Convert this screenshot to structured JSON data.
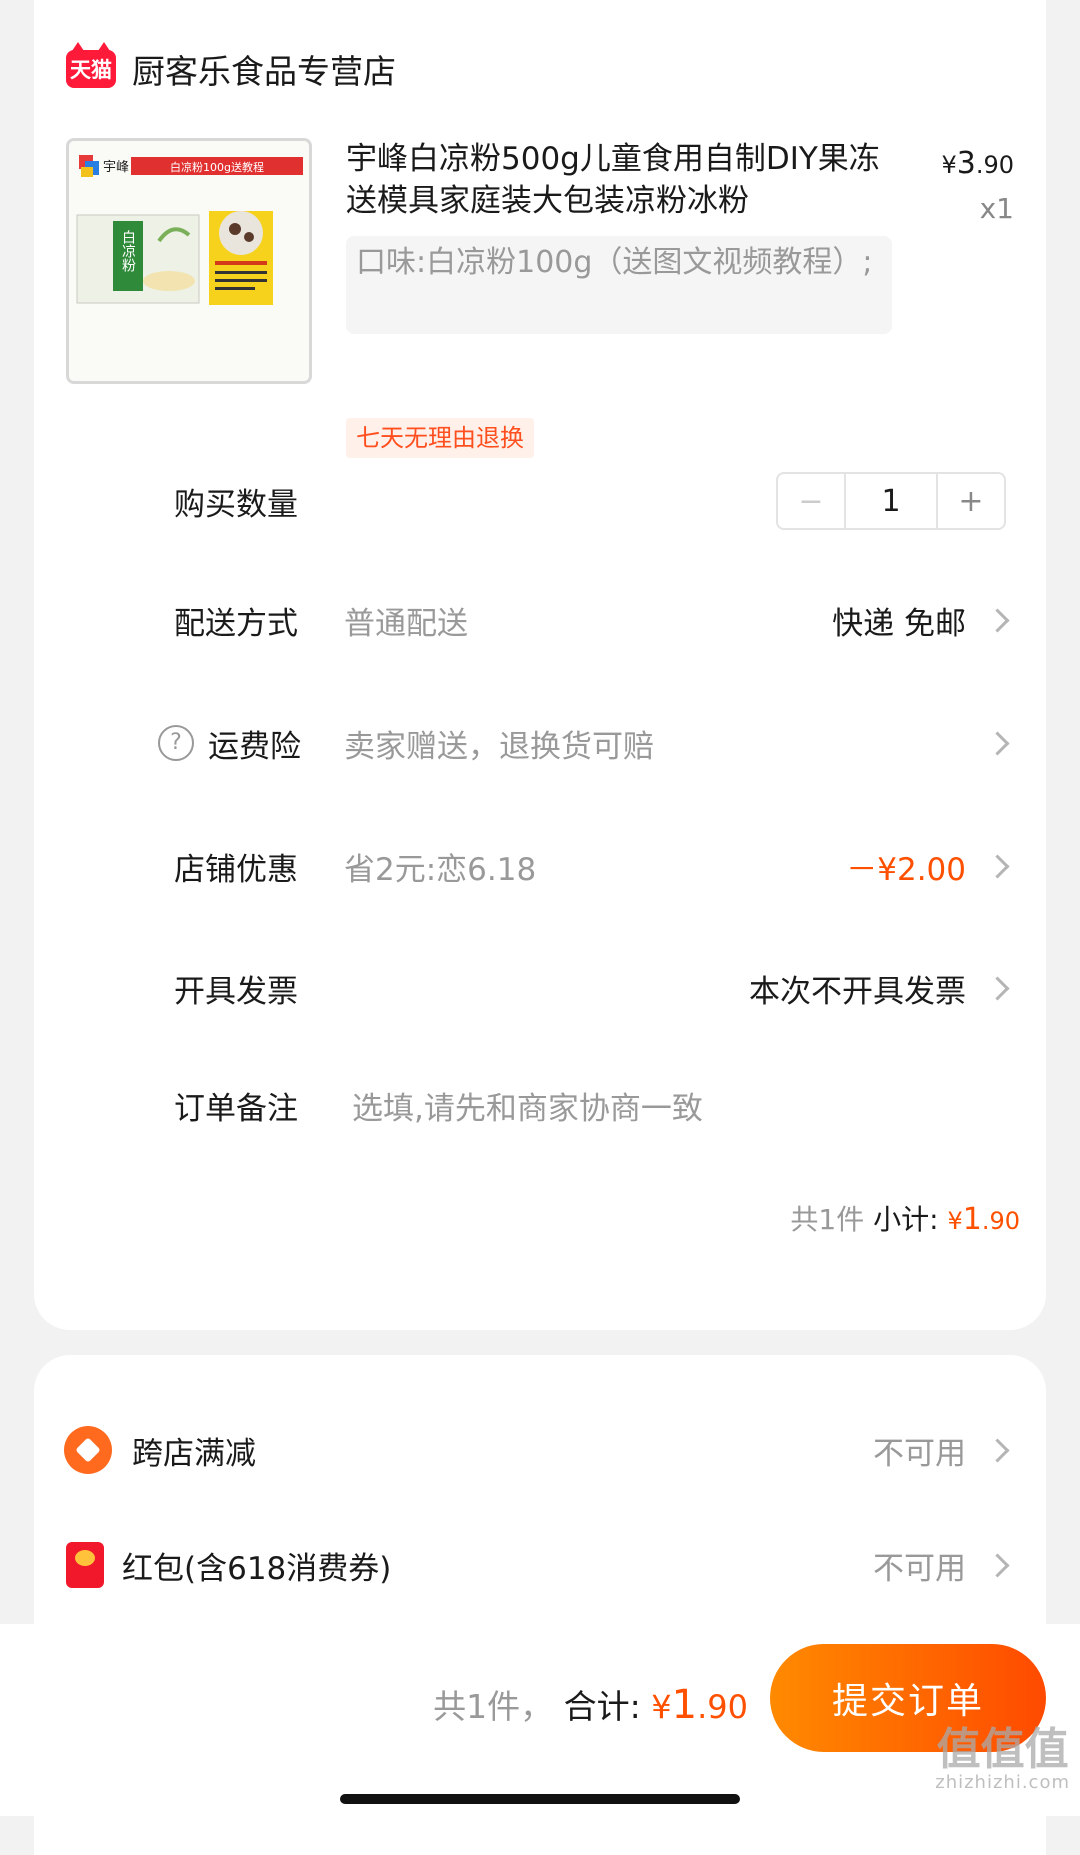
{
  "store": {
    "badge": "天猫",
    "name": "厨客乐食品专营店"
  },
  "product": {
    "image_banner": "白凉粉100g送教程",
    "image_brand": "宇峰",
    "image_pack_text": "白凉粉",
    "title": "宇峰白凉粉500g儿童食用自制DIY果冻送模具家庭装大包装凉粉冰粉",
    "price_symbol": "¥",
    "price_int": "3",
    "price_dec": ".90",
    "quantity": "x1",
    "sku": "口味:白凉粉100g（送图文视频教程）;",
    "return_tag": "七天无理由退换"
  },
  "rows": {
    "quantity": {
      "label": "购买数量",
      "minus": "−",
      "value": "1",
      "plus": "+"
    },
    "delivery": {
      "label": "配送方式",
      "sub": "普通配送",
      "value": "快递 免邮"
    },
    "insurance": {
      "icon": "?",
      "label": "运费险",
      "sub": "卖家赠送，退换货可赔"
    },
    "discount": {
      "label": "店铺优惠",
      "sub": "省2元:恋6.18",
      "value": "－¥2.00"
    },
    "invoice": {
      "label": "开具发票",
      "value": "本次不开具发票"
    },
    "note": {
      "label": "订单备注",
      "placeholder": "选填,请先和商家协商一致"
    }
  },
  "subtotal": {
    "count": "共1件",
    "label": "小计:",
    "symbol": "¥",
    "int": "1",
    "dec": ".90"
  },
  "promos": [
    {
      "label": "跨店满减",
      "value": "不可用"
    },
    {
      "label": "红包(含618消费券)",
      "value": "不可用"
    }
  ],
  "footer": {
    "count": "共1件，",
    "label": "合计:",
    "symbol": "¥",
    "int": "1",
    "dec": ".90",
    "submit": "提交订单"
  },
  "watermark": {
    "main": "值值值",
    "sub": "zhizhizhi.com"
  },
  "colors": {
    "accent": "#ff5000",
    "tmall_red": "#ff1a3a",
    "submit_gradient_start": "#ff8a00",
    "submit_gradient_end": "#ff4a00"
  }
}
